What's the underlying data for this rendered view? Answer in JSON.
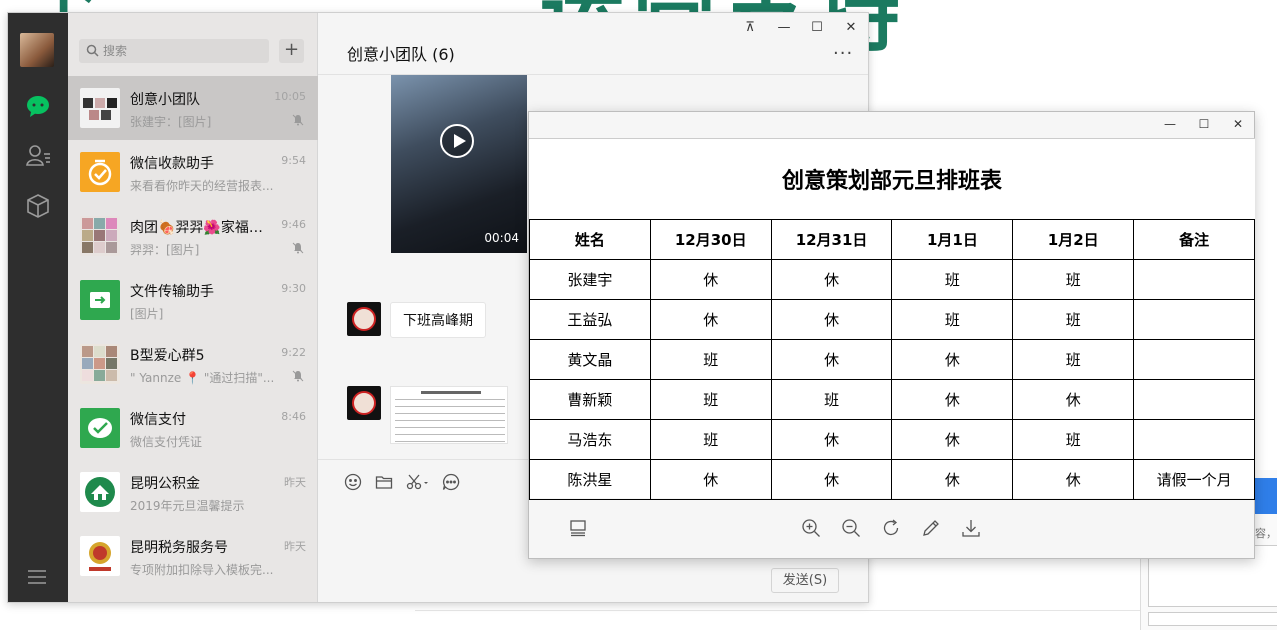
{
  "background": {
    "banner_text": "运营支持",
    "left_glyph": "下"
  },
  "wechat": {
    "search": {
      "placeholder": "搜索"
    },
    "add_label": "+",
    "chats": [
      {
        "name": "创意小团队",
        "time": "10:05",
        "preview": "张建宇：[图片]",
        "muted": true
      },
      {
        "name": "微信收款助手",
        "time": "9:54",
        "preview": "来看看你昨天的经营报表...",
        "muted": false
      },
      {
        "name": "肉团🍖羿羿🌺家福利...",
        "time": "9:46",
        "preview": "羿羿：[图片]",
        "muted": true
      },
      {
        "name": "文件传输助手",
        "time": "9:30",
        "preview": "[图片]",
        "muted": false
      },
      {
        "name": "B型爱心群5",
        "time": "9:22",
        "preview": "\" Yannze 📍 \"通过扫描\"...",
        "muted": true
      },
      {
        "name": "微信支付",
        "time": "8:46",
        "preview": "微信支付凭证",
        "muted": false
      },
      {
        "name": "昆明公积金",
        "time": "昨天",
        "preview": "2019年元旦温馨提示",
        "muted": false
      },
      {
        "name": "昆明税务服务号",
        "time": "昨天",
        "preview": "专项附加扣除导入模板完...",
        "muted": false
      }
    ],
    "conversation": {
      "title": "创意小团队 (6)",
      "more": "···",
      "video_duration": "00:04",
      "text_message": "下班高峰期",
      "send_label": "发送(S)"
    },
    "window_controls": {
      "pin": "⊼",
      "minimize": "—",
      "maximize": "☐",
      "close": "✕"
    }
  },
  "viewer": {
    "window_controls": {
      "minimize": "—",
      "maximize": "☐",
      "close": "✕"
    },
    "sheet": {
      "title": "创意策划部元旦排班表",
      "headers": [
        "姓名",
        "12月30日",
        "12月31日",
        "1月1日",
        "1月2日",
        "备注"
      ],
      "rows": [
        [
          "张建宇",
          "休",
          "休",
          "班",
          "班",
          ""
        ],
        [
          "王益弘",
          "休",
          "休",
          "班",
          "班",
          ""
        ],
        [
          "黄文晶",
          "班",
          "休",
          "休",
          "班",
          ""
        ],
        [
          "曹新颖",
          "班",
          "班",
          "休",
          "休",
          ""
        ],
        [
          "马浩东",
          "班",
          "休",
          "休",
          "班",
          ""
        ],
        [
          "陈洪星",
          "休",
          "休",
          "休",
          "休",
          "请假一个月"
        ]
      ]
    }
  },
  "colors": {
    "wechat_green": "#07c160",
    "rail_bg": "#2e2e2e",
    "banner_green": "#1b7a60"
  }
}
